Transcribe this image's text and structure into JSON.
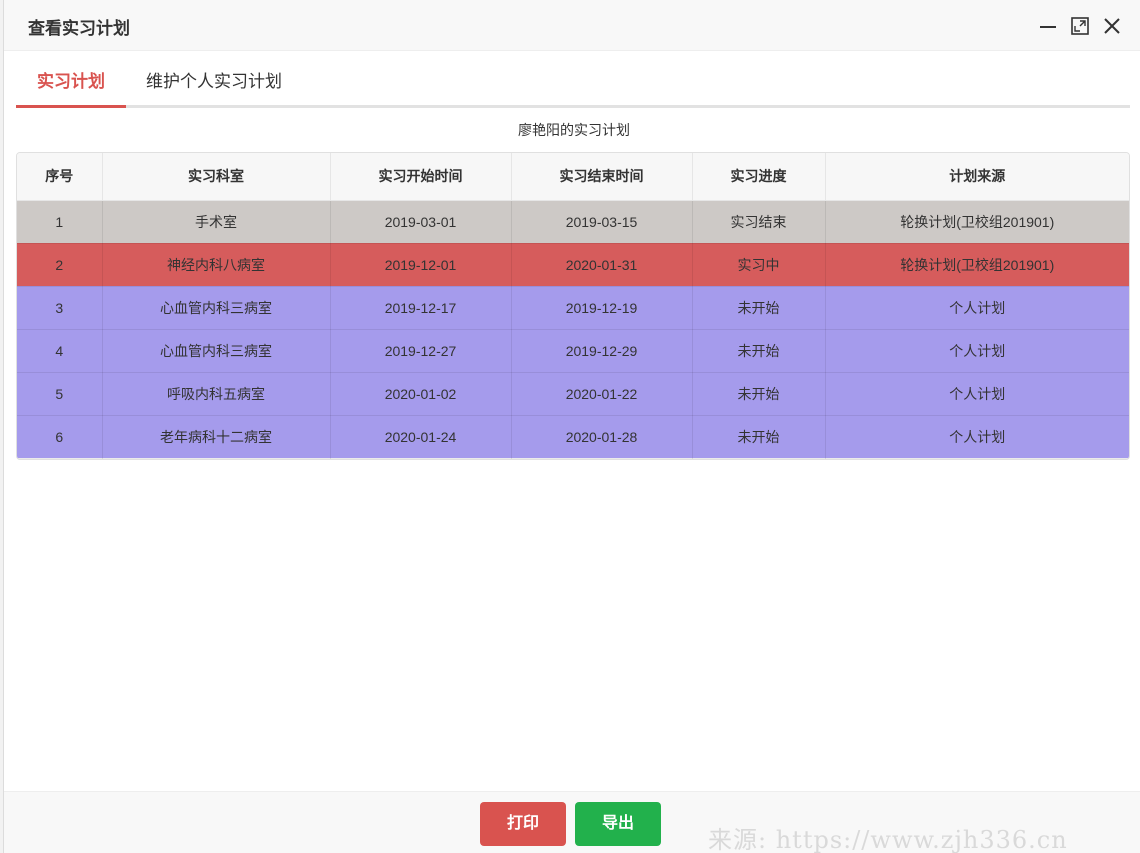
{
  "window": {
    "title": "查看实习计划"
  },
  "tabs": [
    {
      "label": "实习计划",
      "active": true
    },
    {
      "label": "维护个人实习计划",
      "active": false
    }
  ],
  "table": {
    "caption": "廖艳阳的实习计划",
    "headers": [
      "序号",
      "实习科室",
      "实习开始时间",
      "实习结束时间",
      "实习进度",
      "计划来源"
    ],
    "rows": [
      [
        "1",
        "手术室",
        "2019-03-01",
        "2019-03-15",
        "实习结束",
        "轮换计划(卫校组201901)"
      ],
      [
        "2",
        "神经内科八病室",
        "2019-12-01",
        "2020-01-31",
        "实习中",
        "轮换计划(卫校组201901)"
      ],
      [
        "3",
        "心血管内科三病室",
        "2019-12-17",
        "2019-12-19",
        "未开始",
        "个人计划"
      ],
      [
        "4",
        "心血管内科三病室",
        "2019-12-27",
        "2019-12-29",
        "未开始",
        "个人计划"
      ],
      [
        "5",
        "呼吸内科五病室",
        "2020-01-02",
        "2020-01-22",
        "未开始",
        "个人计划"
      ],
      [
        "6",
        "老年病科十二病室",
        "2020-01-24",
        "2020-01-28",
        "未开始",
        "个人计划"
      ]
    ]
  },
  "footer": {
    "print_label": "打印",
    "export_label": "导出"
  },
  "watermark": "来源: https://www.zjh336.cn",
  "colors": {
    "accent": "#d9534f",
    "export": "#22b14c",
    "row_finished": "#cdc9c6",
    "row_in_progress": "#d65c5c",
    "row_not_started": "#a59bec"
  }
}
